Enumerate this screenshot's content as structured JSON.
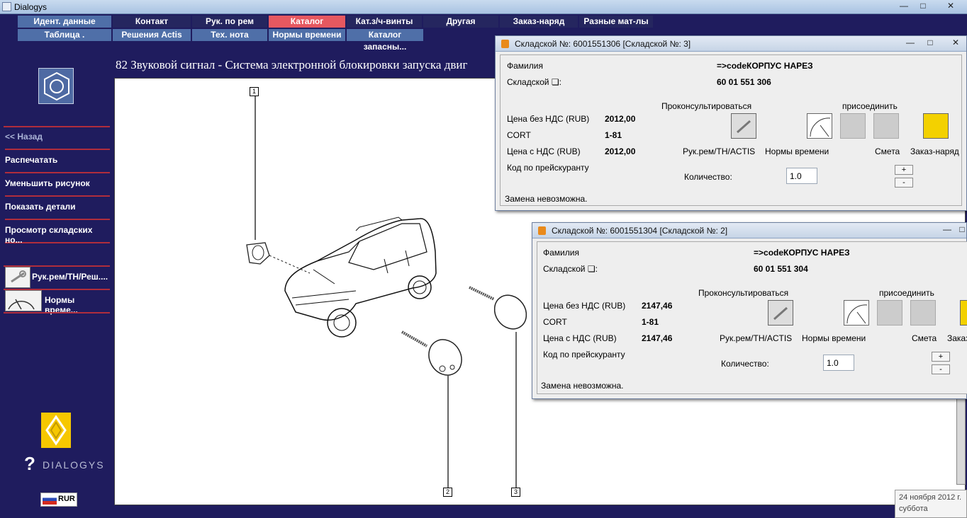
{
  "window": {
    "title": "Dialogys",
    "minimize": "—",
    "maximize": "□",
    "close": "✕"
  },
  "nav": {
    "row1": [
      "Идент. данные",
      "Контакт",
      "Рук. по рем",
      "Каталог запчастей",
      "Кат.з/ч-винты",
      "Другая",
      "Заказ-наряд",
      "Разные мат-лы"
    ],
    "row2": [
      "Таблица .",
      "Решения Actis",
      "Тех. нота",
      "Нормы времени",
      "Каталог запасны..."
    ]
  },
  "sidebar": {
    "back": "<< Назад",
    "print": "Распечатать",
    "shrink": "Уменьшить рисунок",
    "show_details": "Показать детали",
    "stock_view": "Просмотр складских но...",
    "link1": "Рук.рем/ТН/Реш....",
    "link2": "Нормы време..."
  },
  "page": {
    "title": "82 Звуковой сигнал - Система электронной блокировки запуска двиг"
  },
  "callouts": [
    "1",
    "2",
    "3"
  ],
  "dialog1": {
    "title": "Складской №: 6001551306 [Складской №: 3]",
    "surname_label": "Фамилия",
    "surname_value": "=>codeКОРПУС НАРЕЗ",
    "stock_label": "Складской ❏:",
    "stock_value": "60 01 551 306",
    "price_net_label": "Цена без НДС (RUB)",
    "price_net": "2012,00",
    "cort_label": "CORT",
    "cort": "1-81",
    "price_vat_label": "Цена с НДС (RUB)",
    "price_vat": "2012,00",
    "price_code_label": "Код по прейскуранту",
    "consult": "Проконсультироваться",
    "attach": "присоединить",
    "btn_repair": "Рук.рем/ТН/ACTIS",
    "btn_time": "Нормы времени",
    "btn_estimate": "Смета",
    "btn_order": "Заказ-наряд",
    "qty_label": "Количество:",
    "qty": "1.0",
    "status": "Замена невозможна.",
    "plus": "+",
    "minus": "-"
  },
  "dialog2": {
    "title": "Складской №: 6001551304 [Складской №: 2]",
    "surname_label": "Фамилия",
    "surname_value": "=>codeКОРПУС НАРЕЗ",
    "stock_label": "Складской ❏:",
    "stock_value": "60 01 551 304",
    "price_net_label": "Цена без НДС (RUB)",
    "price_net": "2147,46",
    "cort_label": "CORT",
    "cort": "1-81",
    "price_vat_label": "Цена с НДС (RUB)",
    "price_vat": "2147,46",
    "price_code_label": "Код по прейскуранту",
    "consult": "Проконсультироваться",
    "attach": "присоединить",
    "btn_repair": "Рук.рем/ТН/ACTIS",
    "btn_time": "Нормы времени",
    "btn_estimate": "Смета",
    "btn_order": "Заказ",
    "qty_label": "Количество:",
    "qty": "1.0",
    "status": "Замена невозможна.",
    "plus": "+",
    "minus": "-"
  },
  "logo_text": "DIALOGYS",
  "currency": "RUR",
  "date": {
    "line1": "24 ноября 2012 г.",
    "line2": "суббота"
  },
  "colors": {
    "background": "#1f1c5e",
    "nav_active": "#e65860",
    "nav_light": "#4f6fa8",
    "separator": "#b02d3c"
  }
}
